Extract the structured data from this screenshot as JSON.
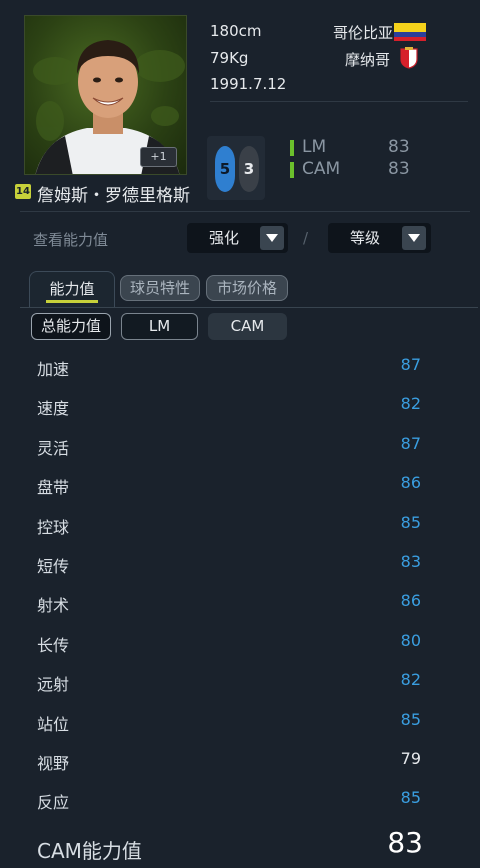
{
  "player": {
    "name": "詹姆斯・罗德里格斯",
    "season_badge": "14",
    "upgrade_badge": "+1",
    "height": "180cm",
    "weight": "79Kg",
    "birthdate": "1991.7.12",
    "nation": "哥伦比亚",
    "club": "摩纳哥",
    "foot_left": "5",
    "foot_right": "3",
    "positions": [
      {
        "label": "LM",
        "value": "83"
      },
      {
        "label": "CAM",
        "value": "83"
      }
    ]
  },
  "controls": {
    "view_label": "查看能力值",
    "enhance_label": "强化",
    "level_label": "等级",
    "separator": "/"
  },
  "tabs": [
    {
      "label": "能力值",
      "active": true
    },
    {
      "label": "球员特性",
      "active": false
    },
    {
      "label": "市场价格",
      "active": false
    }
  ],
  "sub_tabs": [
    {
      "label": "总能力值"
    },
    {
      "label": "LM"
    },
    {
      "label": "CAM"
    }
  ],
  "stats": [
    {
      "name": "加速",
      "value": "87",
      "color": "#3a9ee0"
    },
    {
      "name": "速度",
      "value": "82",
      "color": "#3a9ee0"
    },
    {
      "name": "灵活",
      "value": "87",
      "color": "#3a9ee0"
    },
    {
      "name": "盘带",
      "value": "86",
      "color": "#3a9ee0"
    },
    {
      "name": "控球",
      "value": "85",
      "color": "#3a9ee0"
    },
    {
      "name": "短传",
      "value": "83",
      "color": "#3a9ee0"
    },
    {
      "name": "射术",
      "value": "86",
      "color": "#3a9ee0"
    },
    {
      "name": "长传",
      "value": "80",
      "color": "#3a9ee0"
    },
    {
      "name": "远射",
      "value": "82",
      "color": "#3a9ee0"
    },
    {
      "name": "站位",
      "value": "85",
      "color": "#3a9ee0"
    },
    {
      "name": "视野",
      "value": "79",
      "color": "#e6e9ec"
    },
    {
      "name": "反应",
      "value": "85",
      "color": "#3a9ee0"
    }
  ],
  "total": {
    "label": "CAM能力值",
    "value": "83"
  },
  "colors": {
    "accent_blue": "#3a9ee0",
    "position_green": "#6bbf2c",
    "tab_underline": "#c7d13a"
  }
}
